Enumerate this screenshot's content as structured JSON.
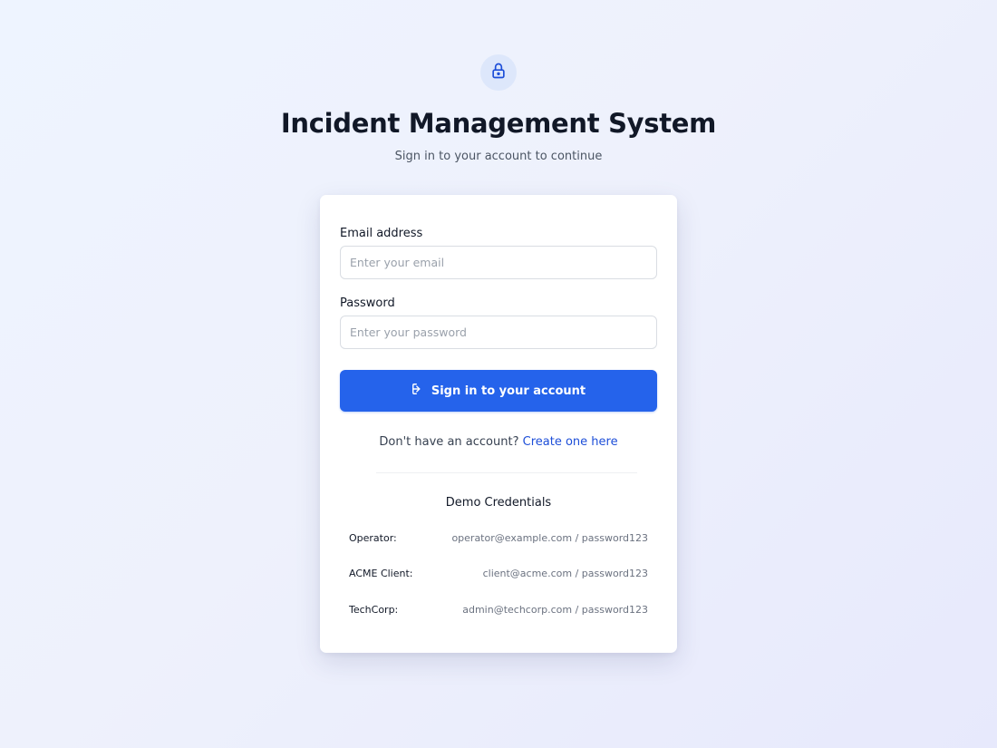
{
  "header": {
    "icon": "lock-icon",
    "title": "Incident Management System",
    "subtitle": "Sign in to your account to continue"
  },
  "form": {
    "email": {
      "label": "Email address",
      "placeholder": "Enter your email",
      "value": ""
    },
    "password": {
      "label": "Password",
      "placeholder": "Enter your password",
      "value": ""
    },
    "submit": {
      "icon": "login-icon",
      "label": "Sign in to your account"
    },
    "signup": {
      "prompt": "Don't have an account?",
      "link_text": "Create one here"
    }
  },
  "demo": {
    "title": "Demo Credentials",
    "credentials": [
      {
        "role": "Operator:",
        "value": "operator@example.com / password123"
      },
      {
        "role": "ACME Client:",
        "value": "client@acme.com / password123"
      },
      {
        "role": "TechCorp:",
        "value": "admin@techcorp.com / password123"
      }
    ]
  },
  "colors": {
    "accent": "#2563eb",
    "link": "#1d4ed8",
    "card_background": "#ffffff"
  }
}
